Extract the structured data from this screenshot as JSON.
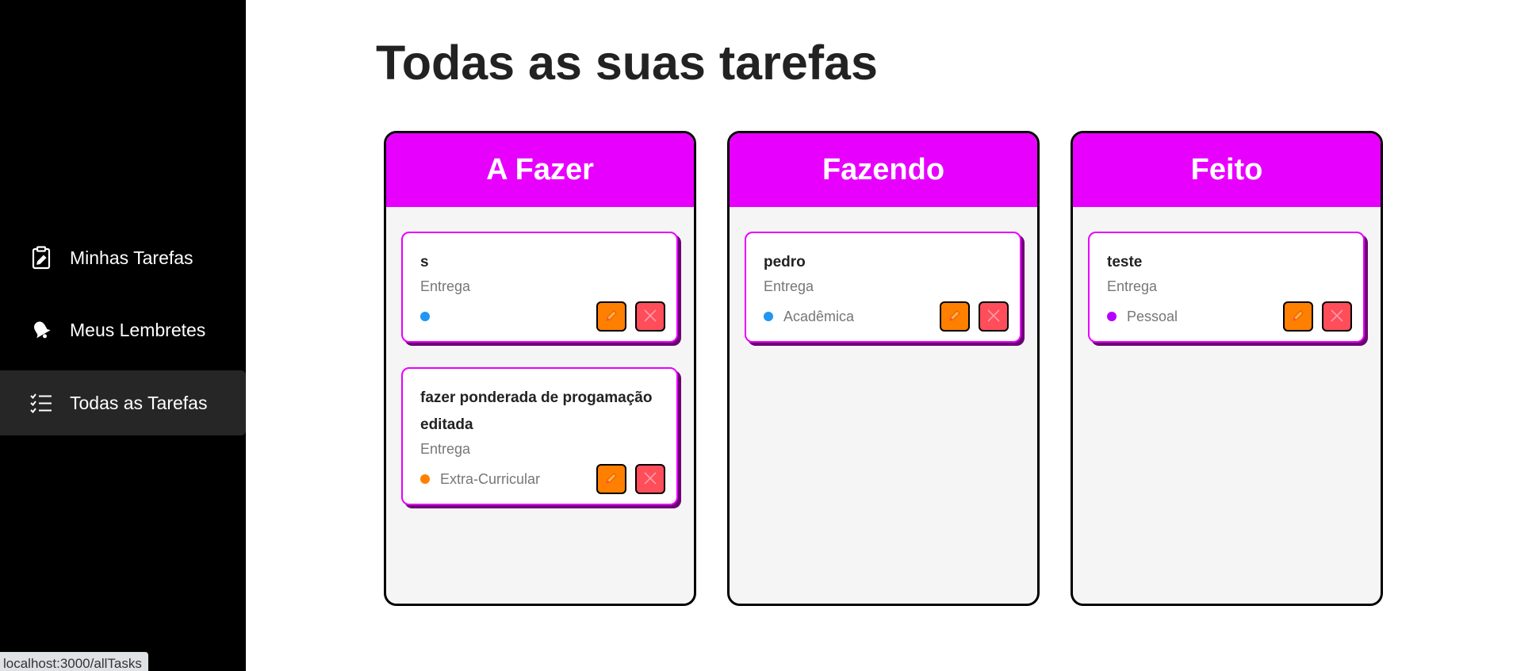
{
  "sidebar": {
    "items": [
      {
        "label": "Minhas Tarefas",
        "icon": "clipboard-edit-icon"
      },
      {
        "label": "Meus Lembretes",
        "icon": "bell-icon"
      },
      {
        "label": "Todas as Tarefas",
        "icon": "checklist-icon",
        "active": true
      }
    ]
  },
  "status_bar": {
    "url": "localhost:3000/allTasks"
  },
  "main": {
    "title": "Todas as suas tarefas",
    "columns": [
      {
        "title": "A Fazer",
        "cards": [
          {
            "title": "s",
            "type": "Entrega",
            "category": "",
            "category_color": "#2196f3"
          },
          {
            "title": "fazer ponderada de progamação editada",
            "type": "Entrega",
            "category": "Extra-Curricular",
            "category_color": "#ff7f00"
          }
        ]
      },
      {
        "title": "Fazendo",
        "cards": [
          {
            "title": "pedro",
            "type": "Entrega",
            "category": "Acadêmica",
            "category_color": "#2196f3"
          }
        ]
      },
      {
        "title": "Feito",
        "cards": [
          {
            "title": "teste",
            "type": "Entrega",
            "category": "Pessoal",
            "category_color": "#b400ff"
          }
        ]
      }
    ]
  },
  "colors": {
    "accent": "#e800ff",
    "edit_button": "#ff7f00",
    "delete_button": "#ff4d5a",
    "sidebar_bg": "#000000"
  }
}
